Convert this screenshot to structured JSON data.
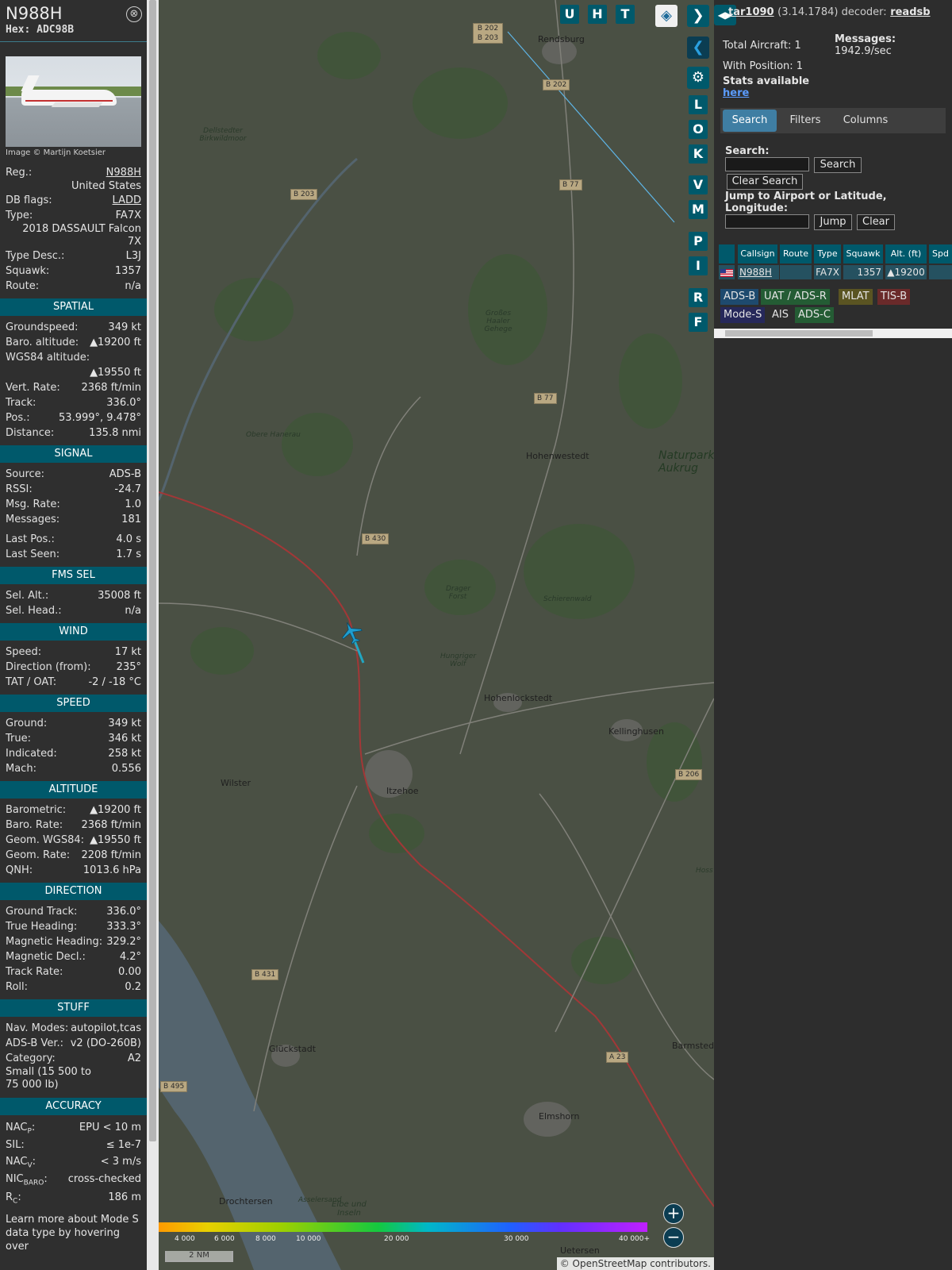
{
  "infoblock": {
    "callsign": "N988H",
    "hex": "Hex: ADC98B",
    "close_icon": "⊗",
    "photo_credit": "Image © Martijn Koetsier",
    "reg_label": "Reg.:",
    "reg_value": "N988H",
    "country": "United States",
    "dbflags_label": "DB flags:",
    "dbflags_value": "LADD",
    "type_label": "Type:",
    "type_value": "FA7X",
    "type_long_1": "2018 DASSAULT Falcon",
    "type_long_2": "7X",
    "typedesc_label": "Type Desc.:",
    "typedesc_value": "L3J",
    "squawk_label": "Squawk:",
    "squawk_value": "1357",
    "route_label": "Route:",
    "route_value": "n/a",
    "sections": {
      "spatial": "SPATIAL",
      "signal": "SIGNAL",
      "fms": "FMS SEL",
      "wind": "WIND",
      "speed": "SPEED",
      "altitude": "ALTITUDE",
      "direction": "DIRECTION",
      "stuff": "STUFF",
      "accuracy": "ACCURACY"
    },
    "spatial": [
      {
        "k": "Groundspeed:",
        "v": "349 kt"
      },
      {
        "k": "Baro. altitude:",
        "v": "▲19200 ft"
      }
    ],
    "wgs84_label": "WGS84 altitude:",
    "wgs84_value": "▲19550 ft",
    "spatial2": [
      {
        "k": "Vert. Rate:",
        "v": "2368 ft/min"
      },
      {
        "k": "Track:",
        "v": "336.0°"
      },
      {
        "k": "Pos.:",
        "v": "53.999°, 9.478°"
      },
      {
        "k": "Distance:",
        "v": "135.8 nmi"
      }
    ],
    "signal": [
      {
        "k": "Source:",
        "v": "ADS-B"
      },
      {
        "k": "RSSI:",
        "v": "-24.7"
      },
      {
        "k": "Msg. Rate:",
        "v": "1.0"
      },
      {
        "k": "Messages:",
        "v": "181"
      }
    ],
    "signal2": [
      {
        "k": "Last Pos.:",
        "v": "4.0 s"
      },
      {
        "k": "Last Seen:",
        "v": "1.7 s"
      }
    ],
    "fms": [
      {
        "k": "Sel. Alt.:",
        "v": "35008 ft"
      },
      {
        "k": "Sel. Head.:",
        "v": "n/a"
      }
    ],
    "wind": [
      {
        "k": "Speed:",
        "v": "17 kt"
      },
      {
        "k": "Direction (from):",
        "v": "235°"
      },
      {
        "k": "TAT / OAT:",
        "v": "-2 / -18 °C"
      }
    ],
    "speed": [
      {
        "k": "Ground:",
        "v": "349 kt"
      },
      {
        "k": "True:",
        "v": "346 kt"
      },
      {
        "k": "Indicated:",
        "v": "258 kt"
      },
      {
        "k": "Mach:",
        "v": "0.556"
      }
    ],
    "altitude": [
      {
        "k": "Barometric:",
        "v": "▲19200 ft"
      },
      {
        "k": "Baro. Rate:",
        "v": "2368 ft/min"
      },
      {
        "k": "Geom. WGS84:",
        "v": "▲19550 ft"
      },
      {
        "k": "Geom. Rate:",
        "v": "2208 ft/min"
      },
      {
        "k": "QNH:",
        "v": "1013.6 hPa"
      }
    ],
    "direction": [
      {
        "k": "Ground Track:",
        "v": "336.0°"
      },
      {
        "k": "True Heading:",
        "v": "333.3°"
      },
      {
        "k": "Magnetic Heading:",
        "v": "329.2°"
      },
      {
        "k": "Magnetic Decl.:",
        "v": "4.2°"
      },
      {
        "k": "Track Rate:",
        "v": "0.00"
      },
      {
        "k": "Roll:",
        "v": "0.2"
      }
    ],
    "stuff": [
      {
        "k": "Nav. Modes:",
        "v": "autopilot,tcas"
      },
      {
        "k": "ADS-B Ver.:",
        "v": "v2 (DO-260B)"
      },
      {
        "k": "Category:",
        "v": "A2"
      }
    ],
    "category_desc": "Small (15 500 to 75 000 lb)",
    "accuracy": {
      "nacp_k": "NAC",
      "nacp_sub": "P",
      "nacp_v": "EPU < 10 m",
      "sil_k": "SIL:",
      "sil_v": "≤ 1e-7",
      "nacv_k": "NAC",
      "nacv_sub": "V",
      "nacv_v": "< 3 m/s",
      "nic_k": "NIC",
      "nic_sub": "BARO",
      "nic_v": "cross-checked",
      "rc_k": "R",
      "rc_sub": "C",
      "rc_v": "186 m"
    },
    "footer": "Learn more about Mode S data type by hovering over"
  },
  "map": {
    "buttons": [
      "U",
      "H",
      "T"
    ],
    "side_buttons": [
      "L",
      "O",
      "K",
      "V",
      "M",
      "P",
      "I",
      "R",
      "F"
    ],
    "places": [
      "Rendsburg",
      "Dellstedter Birkwildmoor",
      "Großes Haaler Gehege",
      "Obere Hanerau",
      "Hohenwestedt",
      "Naturpark Aukrug",
      "Drager Forst",
      "Schierenwald",
      "Hungriger Wolf",
      "Hohenlockstedt",
      "Kellinghusen",
      "Wilster",
      "Itzehoe",
      "Glückstadt",
      "Barmstedt",
      "Elmshorn",
      "Drochtersen",
      "Asselersand",
      "Elbe und Inseln",
      "Uetersen",
      "Hoss"
    ],
    "roads": [
      "B 202 B 203",
      "B 202",
      "B 203",
      "B 77",
      "B 77",
      "B 430",
      "B 206",
      "B 431",
      "A 23",
      "B 495"
    ],
    "altitude_legend": [
      "4 000",
      "6 000",
      "8 000",
      "10 000",
      "20 000",
      "30 000",
      "40 000+"
    ],
    "scale": "2 NM",
    "attribution": "© OpenStreetMap contributors."
  },
  "rightpanel": {
    "title_link": "tar1090",
    "version": "(3.14.1784) decoder:",
    "decoder_link": "readsb",
    "total_aircraft": "Total Aircraft: 1",
    "with_position": "With Position: 1",
    "messages_label": "Messages:",
    "messages_value": "1942.9/sec",
    "stats_label": "Stats available",
    "stats_link": "here",
    "tabs": [
      "Search",
      "Filters",
      "Columns"
    ],
    "search_label": "Search:",
    "search_button": "Search",
    "clear_search": "Clear Search",
    "jump_label": "Jump to Airport or Latitude, Longitude:",
    "jump_button": "Jump",
    "clear_button": "Clear",
    "table_headers": [
      "Callsign",
      "Route",
      "Type",
      "Squawk",
      "Alt. (ft)",
      "Spd"
    ],
    "table_row": {
      "callsign": "N988H",
      "route": "",
      "type": "FA7X",
      "squawk": "1357",
      "alt": "▲19200"
    },
    "sources": [
      "ADS-B",
      "UAT / ADS-R",
      "MLAT",
      "TIS-B",
      "Mode-S",
      "AIS",
      "ADS-C"
    ]
  }
}
